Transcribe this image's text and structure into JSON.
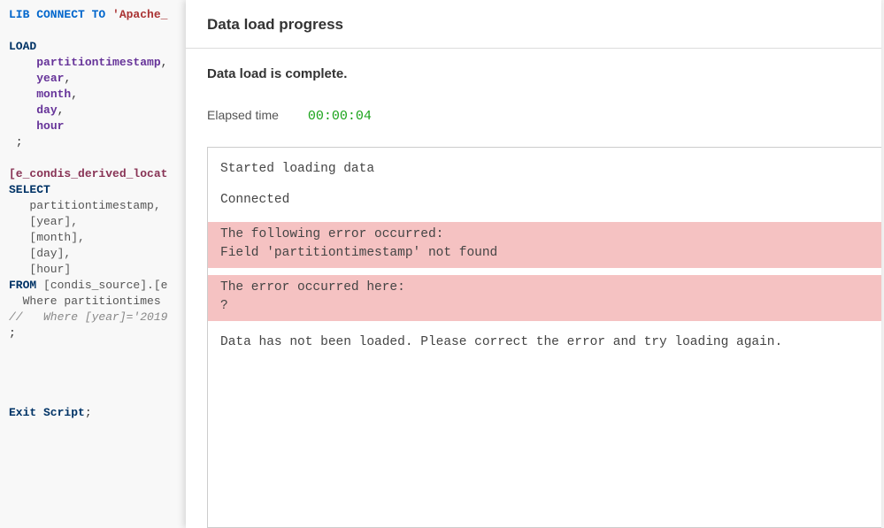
{
  "code": {
    "lib_kw": "LIB CONNECT TO",
    "lib_str": " 'Apache_",
    "load_kw": "LOAD",
    "fields_load": [
      "partitiontimestamp",
      "year",
      "month",
      "day",
      "hour"
    ],
    "semi": " ;",
    "table_name": "[e_condis_derived_locat",
    "select_kw": "SELECT",
    "fields_select": [
      "partitiontimestamp,",
      "[year],",
      "[month],",
      "[day],",
      "[hour]"
    ],
    "from_kw": "FROM",
    "from_rest": " [condis_source].[e",
    "where_line": "  Where partitiontimes",
    "comment_line": "//   Where [year]='2019",
    "semi2": ";",
    "exit_kw": "Exit Script",
    "exit_semi": ";"
  },
  "modal": {
    "title": "Data load progress",
    "subtitle": "Data load is complete.",
    "elapsed_label": "Elapsed time",
    "elapsed_value": "00:00:04",
    "console": {
      "line1": "Started loading data",
      "line2": "Connected",
      "err1a": "The following error occurred:",
      "err1b": "Field 'partitiontimestamp' not found",
      "err2a": "The error occurred here:",
      "err2b": "?",
      "line3": "Data has not been loaded. Please correct the error and try loading again."
    }
  }
}
